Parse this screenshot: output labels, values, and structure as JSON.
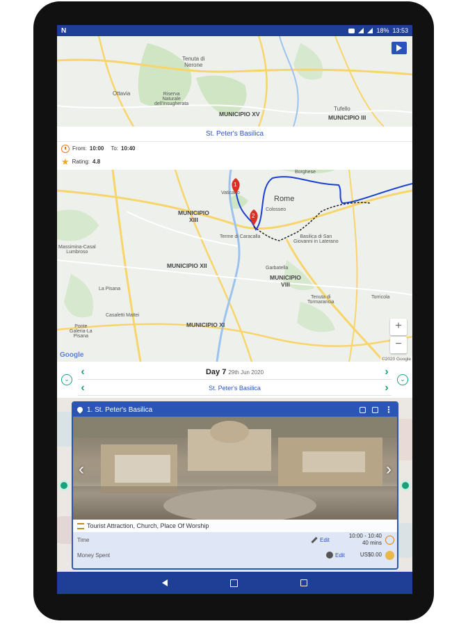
{
  "status_bar": {
    "app_icon": "N",
    "battery": "18%",
    "time": "13:53"
  },
  "top_map": {
    "labels": [
      {
        "text": "Tenuta di\nNerone"
      },
      {
        "text": "Riserva\nNaturale\ndell'Insugherata"
      },
      {
        "text": "Ottavia"
      },
      {
        "text": "MUNICIPIO XV"
      },
      {
        "text": "Tufello"
      },
      {
        "text": "MUNICIPIO III"
      }
    ]
  },
  "info_card": {
    "title": "St. Peter's Basilica",
    "from_label": "From:",
    "from_time": "10:00",
    "to_label": "To:",
    "to_time": "10:40",
    "rating_label": "Rating:",
    "rating": "4.8"
  },
  "route_map": {
    "labels": [
      {
        "text": "Rome",
        "big": true
      },
      {
        "text": "MUNICIPIO\nXIII"
      },
      {
        "text": "MUNICIPIO XII"
      },
      {
        "text": "MUNICIPIO\nVIII"
      },
      {
        "text": "MUNICIPIO XI"
      },
      {
        "text": "Terme di Caracalla"
      },
      {
        "text": "Basilica di San\nGiovanni in Laterano"
      },
      {
        "text": "Garbatella"
      },
      {
        "text": "Vaticano"
      },
      {
        "text": "Tenuta di\nTormarancia"
      },
      {
        "text": "Torricola"
      },
      {
        "text": "La Pisana"
      },
      {
        "text": "Casaletti Mattei"
      },
      {
        "text": "Ponte\nGaleria-La\nPisana"
      },
      {
        "text": "Massimina-Casal\nLumbroso"
      },
      {
        "text": "Borghese"
      },
      {
        "text": "Colosseo"
      }
    ],
    "markers": [
      "1",
      "2"
    ],
    "google_label": "Google",
    "copyright": "©2020 Google",
    "zoom_in": "+",
    "zoom_out": "−"
  },
  "day_nav": {
    "day_label": "Day 7",
    "date": "29th Jun 2020",
    "place": "St. Peter's Basilica",
    "prev": "‹",
    "next": "›"
  },
  "stop_card": {
    "title": "1. St. Peter's Basilica",
    "categories": "Tourist Attraction, Church, Place Of Worship",
    "time_label": "Time",
    "time_edit": "Edit",
    "time_range": "10:00 - 10:40",
    "duration": "40 mins",
    "money_label": "Money Spent",
    "money_edit": "Edit",
    "money_value": "US$0.00"
  },
  "colors": {
    "brand_blue": "#1f3e96",
    "accent_blue": "#2b55b5",
    "green": "#1aa07a",
    "orange": "#e07b1b",
    "route_blue": "#1a3fd1",
    "marker_red": "#d93025"
  }
}
